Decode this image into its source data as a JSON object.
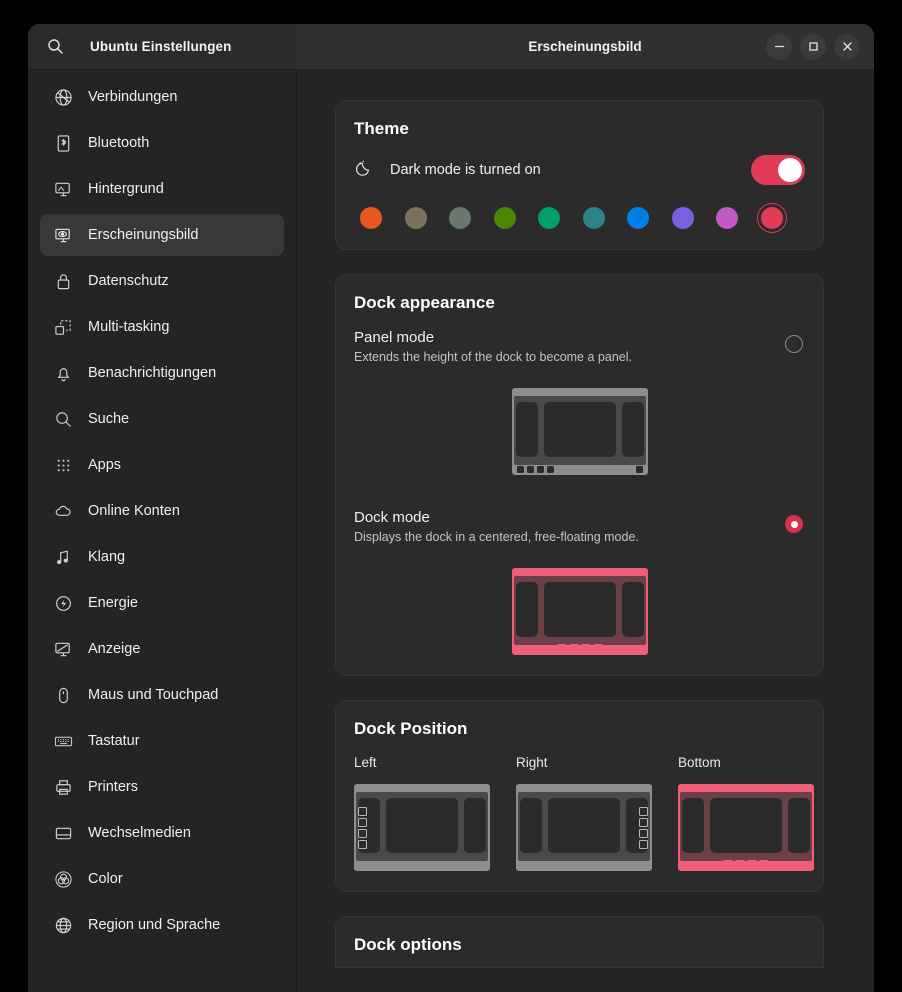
{
  "window": {
    "sidebar_title": "Ubuntu Einstellungen",
    "page_title": "Erscheinungsbild",
    "search_icon": "search-icon",
    "minimize_label": "–",
    "maximize_label": "□",
    "close_label": "×"
  },
  "sidebar": {
    "items": [
      {
        "label": "Verbindungen",
        "icon": "network-icon",
        "active": false
      },
      {
        "label": "Bluetooth",
        "icon": "bluetooth-icon",
        "active": false
      },
      {
        "label": "Hintergrund",
        "icon": "wallpaper-icon",
        "active": false
      },
      {
        "label": "Erscheinungsbild",
        "icon": "appearance-icon",
        "active": true
      },
      {
        "label": "Datenschutz",
        "icon": "lock-icon",
        "active": false
      },
      {
        "label": "Multi-tasking",
        "icon": "windows-icon",
        "active": false
      },
      {
        "label": "Benachrichtigungen",
        "icon": "bell-icon",
        "active": false
      },
      {
        "label": "Suche",
        "icon": "search-icon",
        "active": false
      },
      {
        "label": "Apps",
        "icon": "grid-dots-icon",
        "active": false
      },
      {
        "label": "Online Konten",
        "icon": "cloud-icon",
        "active": false
      },
      {
        "label": "Klang",
        "icon": "music-note-icon",
        "active": false
      },
      {
        "label": "Energie",
        "icon": "power-icon",
        "active": false
      },
      {
        "label": "Anzeige",
        "icon": "display-icon",
        "active": false
      },
      {
        "label": "Maus und Touchpad",
        "icon": "mouse-icon",
        "active": false
      },
      {
        "label": "Tastatur",
        "icon": "keyboard-icon",
        "active": false
      },
      {
        "label": "Printers",
        "icon": "printer-icon",
        "active": false
      },
      {
        "label": "Wechselmedien",
        "icon": "removable-media-icon",
        "active": false
      },
      {
        "label": "Color",
        "icon": "color-icon",
        "active": false
      },
      {
        "label": "Region und Sprache",
        "icon": "globe-icon",
        "active": false
      }
    ]
  },
  "theme": {
    "title": "Theme",
    "dark_mode_label": "Dark mode is turned on",
    "dark_mode_icon": "moon-icon",
    "dark_mode_on": true,
    "toggle_color": "#e03a56",
    "accents": [
      {
        "name": "orange",
        "color": "#e9561f",
        "selected": false
      },
      {
        "name": "bark",
        "color": "#7c7259",
        "selected": false
      },
      {
        "name": "sage",
        "color": "#68786c",
        "selected": false
      },
      {
        "name": "olive",
        "color": "#4b8700",
        "selected": false
      },
      {
        "name": "viridian",
        "color": "#00a06a",
        "selected": false
      },
      {
        "name": "prussian-green",
        "color": "#2f8287",
        "selected": false
      },
      {
        "name": "blue",
        "color": "#007ee5",
        "selected": false
      },
      {
        "name": "purple",
        "color": "#7a61e0",
        "selected": false
      },
      {
        "name": "magenta",
        "color": "#c15ac2",
        "selected": false
      },
      {
        "name": "red",
        "color": "#e03a56",
        "selected": true
      }
    ]
  },
  "dock_appearance": {
    "title": "Dock appearance",
    "options": [
      {
        "title": "Panel mode",
        "description": "Extends the height of the dock to become a panel.",
        "selected": false
      },
      {
        "title": "Dock mode",
        "description": "Displays the dock in a centered, free-floating mode.",
        "selected": true
      }
    ]
  },
  "dock_position": {
    "title": "Dock Position",
    "options": [
      {
        "label": "Left",
        "selected": false
      },
      {
        "label": "Right",
        "selected": false
      },
      {
        "label": "Bottom",
        "selected": true
      }
    ]
  },
  "dock_options": {
    "title": "Dock options"
  }
}
